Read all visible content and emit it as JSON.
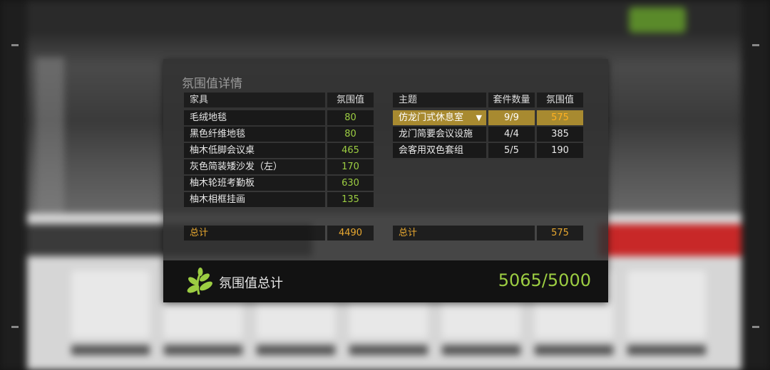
{
  "dialog": {
    "title": "氛围值详情",
    "furniture_table": {
      "headers": [
        "家具",
        "氛围值"
      ],
      "rows": [
        {
          "name": "毛绒地毯",
          "value": "80"
        },
        {
          "name": "黑色纤维地毯",
          "value": "80"
        },
        {
          "name": "柚木低脚会议桌",
          "value": "465"
        },
        {
          "name": "灰色简装矮沙发（左）",
          "value": "170"
        },
        {
          "name": "柚木轮班考勤板",
          "value": "630"
        },
        {
          "name": "柚木相框挂画",
          "value": "135"
        }
      ],
      "total_label": "总计",
      "total_value": "4490"
    },
    "theme_table": {
      "headers": [
        "主题",
        "套件数量",
        "氛围值"
      ],
      "rows": [
        {
          "name": "仿龙门式休息室",
          "count": "9/9",
          "value": "575",
          "selected": true
        },
        {
          "name": "龙门简要会议设施",
          "count": "4/4",
          "value": "385"
        },
        {
          "name": "会客用双色套组",
          "count": "5/5",
          "value": "190"
        }
      ],
      "total_label": "总计",
      "total_value": "575"
    },
    "footer": {
      "label": "氛围值总计",
      "total": "5065/5000",
      "icon": "leaf-icon"
    }
  },
  "colors": {
    "accent_green": "#9ccd42",
    "total_gold": "#e8a830",
    "selected_bg": "#a88a30"
  }
}
